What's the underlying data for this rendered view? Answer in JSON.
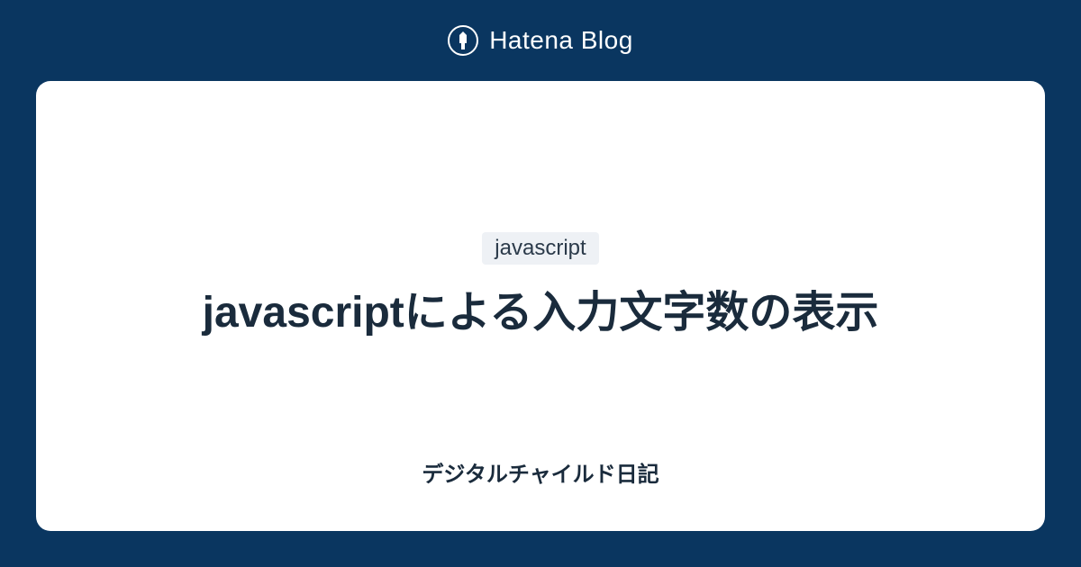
{
  "header": {
    "brand": "Hatena Blog"
  },
  "card": {
    "tag": "javascript",
    "title": "javascriptによる入力文字数の表示",
    "blog_name": "デジタルチャイルド日記"
  },
  "colors": {
    "background": "#0a3660",
    "card_background": "#ffffff",
    "tag_background": "#eef1f5",
    "text_primary": "#1a2b3c"
  }
}
